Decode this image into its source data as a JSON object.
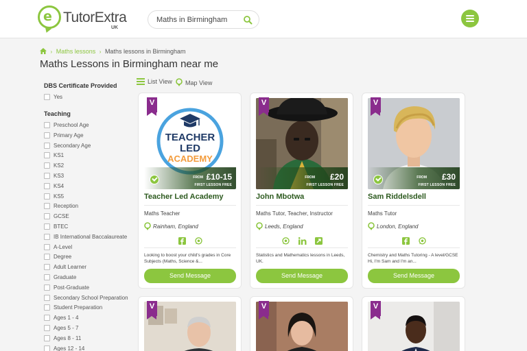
{
  "header": {
    "logo_text": "TutorExtra",
    "logo_region": "UK",
    "search_value": "Maths in Birmingham"
  },
  "breadcrumb": {
    "items": [
      "Maths lessons",
      "Maths lessons in Birmingham"
    ]
  },
  "page_title": "Maths Lessons in Birmingham near me",
  "views": {
    "list": "List View",
    "map": "Map View"
  },
  "filters": {
    "dbs_heading": "DBS Certificate Provided",
    "dbs_options": [
      "Yes"
    ],
    "teaching_heading": "Teaching",
    "teaching_options": [
      "Preschool Age",
      "Primary Age",
      "Secondary Age",
      "KS1",
      "KS2",
      "KS3",
      "KS4",
      "KS5",
      "Reception",
      "GCSE",
      "BTEC",
      "IB International Baccalaureate",
      "A-Level",
      "Degree",
      "Adult Learner",
      "Graduate",
      "Post-Graduate",
      "Secondary School Preparation",
      "Student Preparation",
      "Ages 1 - 4",
      "Ages 5 - 7",
      "Ages 8 - 11",
      "Ages 12 - 14"
    ]
  },
  "cards": [
    {
      "badge": "V",
      "logo_line1": "TEACHER",
      "logo_line2": "LED",
      "logo_line3": "ACADEMY",
      "price_from": "FROM",
      "price": "£10-15",
      "price_note": "FIRST LESSON FREE",
      "name": "Teacher Led Academy",
      "role": "Maths Teacher",
      "location": "Rainham, England",
      "description": "Looking to boost your child's grades in Core Subjects (Maths, Science &...",
      "button": "Send Message"
    },
    {
      "badge": "V",
      "price_from": "FROM",
      "price": "£20",
      "price_note": "FIRST LESSON FREE",
      "name": "John Mbotwa",
      "role": "Maths Tutor, Teacher, Instructor",
      "location": "Leeds, England",
      "description": "Statistics and Mathematics lessons in Leeds, UK.",
      "button": "Send Message"
    },
    {
      "badge": "V",
      "price_from": "FROM",
      "price": "£30",
      "price_note": "FIRST LESSON FREE",
      "name": "Sam Riddelsdell",
      "role": "Maths Tutor",
      "location": "London, England",
      "description": "Chemistry and Maths Tutoring - A level/GCSE Hi, I'm Sam and I'm an...",
      "button": "Send Message"
    },
    {
      "badge": "V"
    },
    {
      "badge": "V"
    },
    {
      "badge": "V"
    }
  ],
  "colors": {
    "accent_green": "#8cc63f",
    "name_green": "#2d5a1f",
    "verified_purple": "#8a2c8d"
  }
}
